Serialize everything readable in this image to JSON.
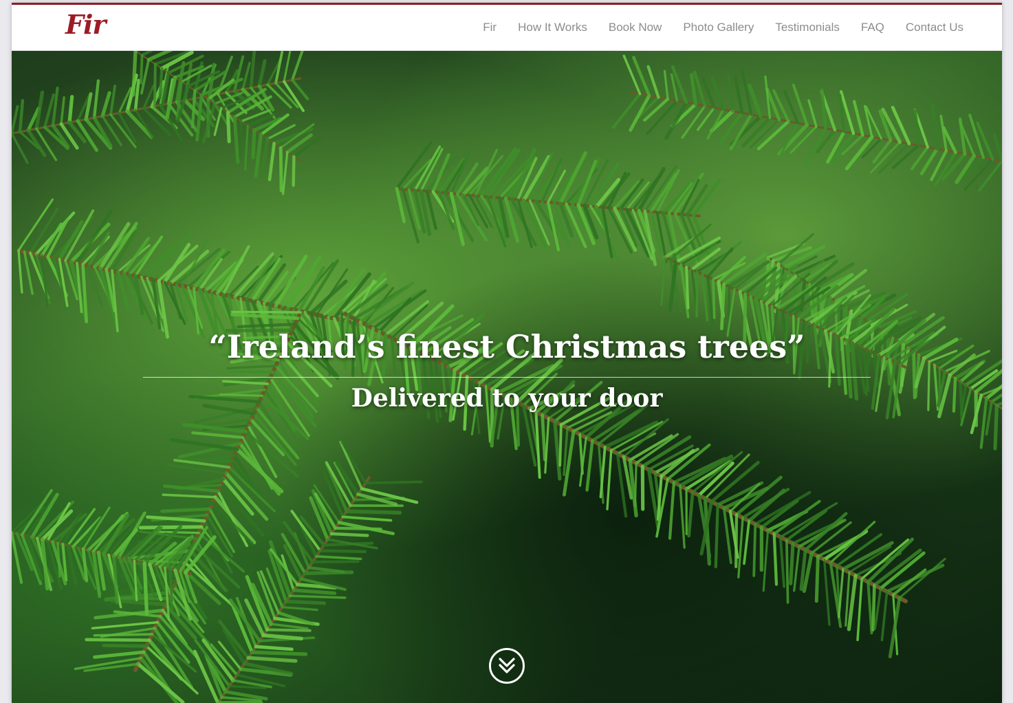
{
  "header": {
    "logo_text": "Fir",
    "nav": [
      {
        "label": "Fir"
      },
      {
        "label": "How It Works"
      },
      {
        "label": "Book Now"
      },
      {
        "label": "Photo Gallery"
      },
      {
        "label": "Testimonials"
      },
      {
        "label": "FAQ"
      },
      {
        "label": "Contact Us"
      }
    ]
  },
  "hero": {
    "headline": "“Ireland’s finest Christmas trees”",
    "subheadline": "Delivered to your door",
    "background_icon": "fir-branch-photo",
    "scroll_icon": "double-chevron-down-icon"
  },
  "colors": {
    "brand": "#9b1c25",
    "nav_text": "#8c8c8c",
    "hero_text": "#ffffff"
  }
}
